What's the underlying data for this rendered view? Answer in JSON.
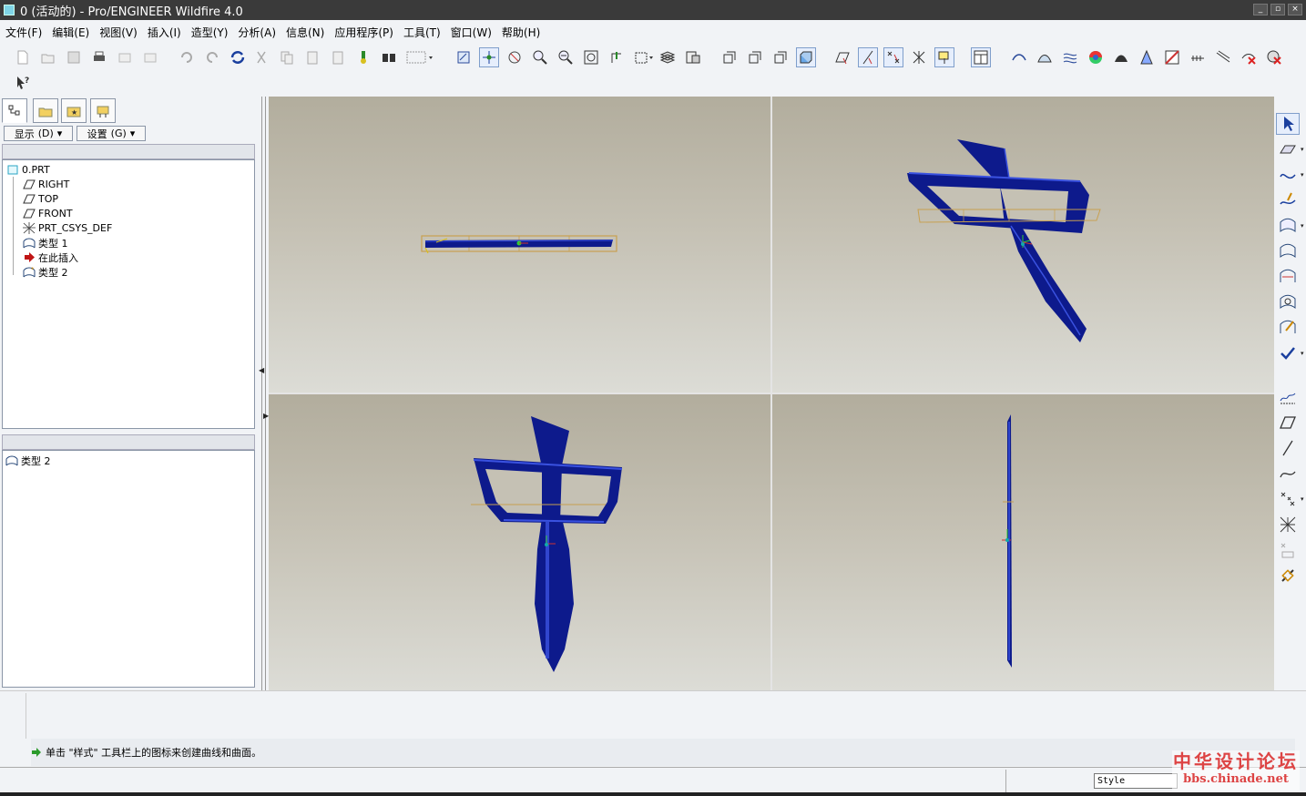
{
  "window": {
    "title": "0 (活动的) - Pro/ENGINEER Wildfire 4.0"
  },
  "menu": {
    "items": [
      "文件(F)",
      "编辑(E)",
      "视图(V)",
      "插入(I)",
      "造型(Y)",
      "分析(A)",
      "信息(N)",
      "应用程序(P)",
      "工具(T)",
      "窗口(W)",
      "帮助(H)"
    ]
  },
  "colors": {
    "model_fill": "#0d1a8c",
    "model_highlight": "#3a52e0",
    "datum_plane": "#c8a050",
    "accent": "#7f9ecb"
  },
  "navigator": {
    "show_label": "显示",
    "show_key": "(D)",
    "settings_label": "设置",
    "settings_key": "(G)",
    "tree": {
      "root": "0.PRT",
      "items": [
        {
          "label": "RIGHT",
          "icon": "datum-plane-icon"
        },
        {
          "label": "TOP",
          "icon": "datum-plane-icon"
        },
        {
          "label": "FRONT",
          "icon": "datum-plane-icon"
        },
        {
          "label": "PRT_CSYS_DEF",
          "icon": "csys-icon"
        },
        {
          "label": "类型 1",
          "icon": "style-feature-icon"
        },
        {
          "label": "在此插入",
          "icon": "insert-here-arrow-icon"
        },
        {
          "label": "类型 2",
          "icon": "style-feature-active-icon"
        }
      ]
    },
    "lower_item": "类型 2"
  },
  "message": {
    "text": "单击 \"样式\" 工具栏上的图标来创建曲线和曲面。"
  },
  "status": {
    "filter_value": "Style"
  },
  "watermark": {
    "line1": "中华设计论坛",
    "line2": "bbs.chinade.net"
  }
}
